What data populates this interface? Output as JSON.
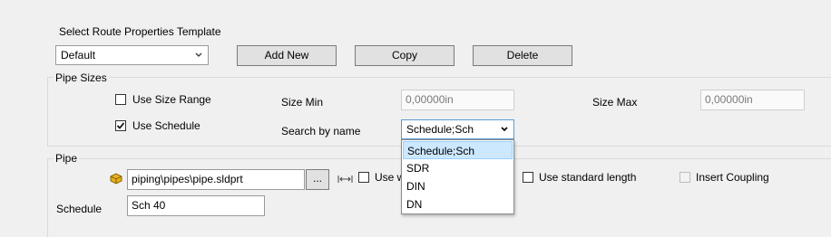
{
  "template": {
    "label": "Select Route Properties Template",
    "selected": "Default",
    "add_new": "Add New",
    "copy": "Copy",
    "delete": "Delete"
  },
  "pipe_sizes": {
    "group_label": "Pipe Sizes",
    "use_size_range": "Use Size Range",
    "use_size_range_checked": false,
    "use_schedule": "Use Schedule",
    "use_schedule_checked": true,
    "size_min_label": "Size Min",
    "size_min_value": "0,00000in",
    "size_max_label": "Size Max",
    "size_max_value": "0,00000in",
    "search_by_name_label": "Search by name",
    "search_by_name_value": "Schedule;Sch",
    "search_options": [
      "Schedule;Sch",
      "SDR",
      "DIN",
      "DN"
    ]
  },
  "pipe": {
    "group_label": "Pipe",
    "part_path": "piping\\pipes\\pipe.sldprt",
    "browse": "...",
    "use_w_label": "Use w",
    "use_standard_length": "Use standard length",
    "insert_coupling": "Insert Coupling",
    "schedule_label": "Schedule",
    "schedule_value": "Sch 40"
  },
  "icons": [
    "chevron-down-icon",
    "part-icon",
    "length-icon",
    "check-icon"
  ]
}
